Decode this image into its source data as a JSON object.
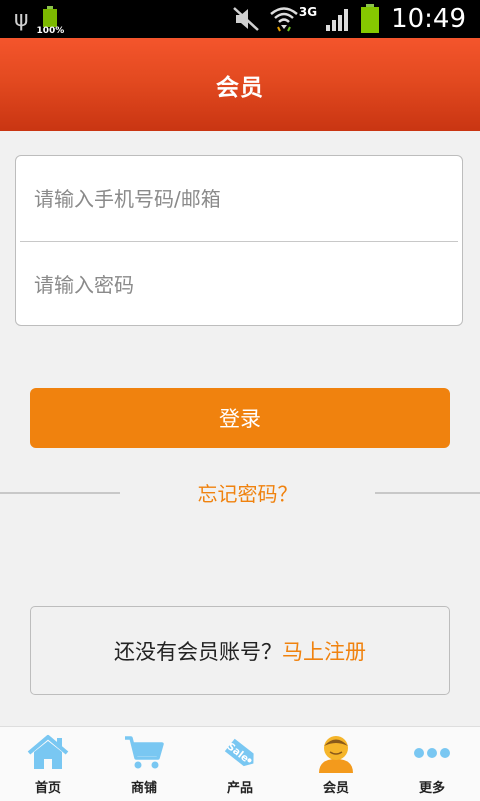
{
  "status_bar": {
    "battery_small_pct": "100%",
    "network": "3G",
    "time": "10:49",
    "icons": [
      "usb-icon",
      "battery-icon",
      "mute-icon",
      "wifi-icon",
      "signal-icon",
      "battery-icon"
    ]
  },
  "header": {
    "title": "会员"
  },
  "form": {
    "phone_placeholder": "请输入手机号码/邮箱",
    "phone_value": "",
    "password_placeholder": "请输入密码",
    "password_value": ""
  },
  "login_button": "登录",
  "forgot_password": "忘记密码？",
  "register": {
    "question": "还没有会员账号？",
    "link": "马上注册"
  },
  "nav": {
    "items": [
      {
        "label": "首页",
        "icon": "home-icon"
      },
      {
        "label": "商铺",
        "icon": "cart-icon"
      },
      {
        "label": "产品",
        "icon": "sale-tag-icon"
      },
      {
        "label": "会员",
        "icon": "member-avatar-icon"
      },
      {
        "label": "更多",
        "icon": "more-dots-icon"
      }
    ]
  },
  "colors": {
    "accent": "#f0820e",
    "header": "#e34a20",
    "nav_icon": "#79c7f2"
  }
}
